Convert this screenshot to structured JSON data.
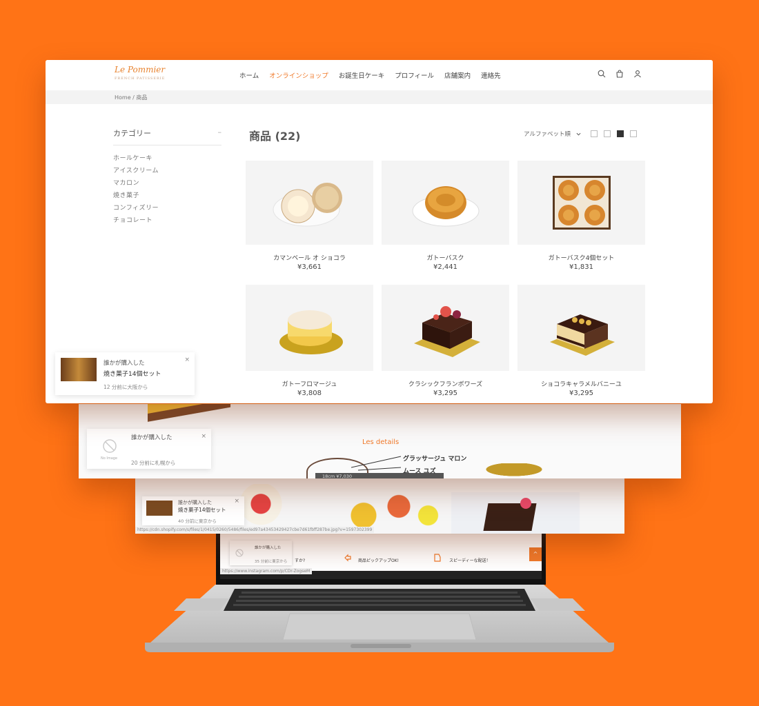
{
  "header": {
    "logo_text": "Le Pommier",
    "logo_sub": "FRENCH PATISSERIE",
    "nav": [
      "ホーム",
      "オンラインショップ",
      "お誕生日ケーキ",
      "プロフィール",
      "店舗案内",
      "連絡先"
    ],
    "active_nav": "オンラインショップ"
  },
  "breadcrumb": "Home / 商品",
  "sidebar": {
    "title": "カテゴリー",
    "toggle": "–",
    "items": [
      "ホールケーキ",
      "アイスクリーム",
      "マカロン",
      "焼き菓子",
      "コンフィズリー",
      "チョコレート"
    ]
  },
  "products": {
    "title": "商品 (22)",
    "sort_label": "アルファベット順",
    "items": [
      {
        "name": "カマンベール オ ショコラ",
        "price": "¥3,661"
      },
      {
        "name": "ガトーバスク",
        "price": "¥2,441"
      },
      {
        "name": "ガトーバスク4個セット",
        "price": "¥1,831"
      },
      {
        "name": "ガトーフロマージュ",
        "price": "¥3,808"
      },
      {
        "name": "クラシックフランボワーズ",
        "price": "¥3,295"
      },
      {
        "name": "ショコラキャラメルバニーユ",
        "price": "¥3,295"
      }
    ]
  },
  "popup_main": {
    "title": "誰かが購入した",
    "item": "焼き菓子14個セット",
    "time": "12 分前に大阪から",
    "close": "×"
  },
  "popup_second": {
    "title": "誰かが購入した",
    "no_image": "No Image",
    "time": "20 分前に札幌から",
    "close": "×"
  },
  "popup_third": {
    "title": "誰かが購入した",
    "item": "焼き菓子14個セット",
    "time": "40 分前に東京から",
    "close": "×"
  },
  "popup_laptop": {
    "title": "誰かが購入した",
    "time": "35 分前に東京から"
  },
  "layer2": {
    "details": "Les details",
    "label1": "グラッサージュ マロン",
    "label2": "ムース ユズ",
    "size": "18cm ¥7,030"
  },
  "layer3": {
    "url": "https://cdn.shopify.com/s/files/1/0415/0260/5486/files/ed97a43453429427cbe7d61fbff287be.jpg?v=1597302399"
  },
  "laptop": {
    "q": "すか?",
    "pickup": "商品ピックアップOK!",
    "delivery": "スピーディーな配送！",
    "url": "https://www.instagram.com/p/CDr-ZogseM"
  },
  "colors": {
    "background": "#ff7316",
    "accent": "#f07a2b"
  }
}
